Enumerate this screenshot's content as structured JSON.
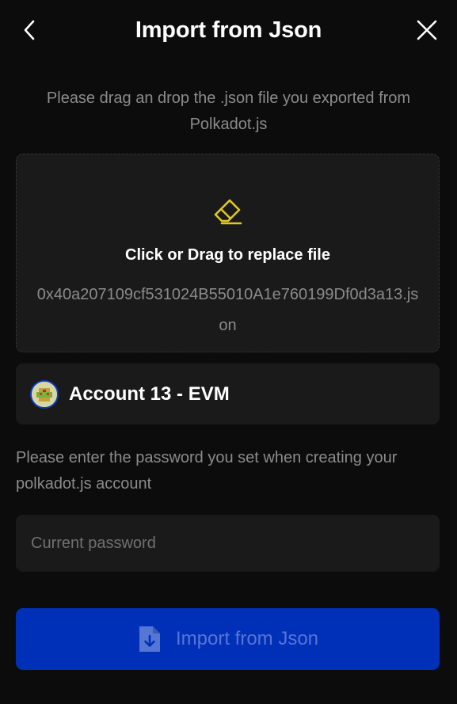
{
  "header": {
    "title": "Import from Json",
    "back_icon": "chevron-left-icon",
    "close_icon": "close-icon"
  },
  "instructions": "Please drag an drop the .json file you exported from Polkadot.js",
  "dropzone": {
    "icon": "eraser-icon",
    "label": "Click or Drag to replace file",
    "filename": "0x40a207109cf531024B55010A1e760199Df0d3a13.json"
  },
  "account": {
    "name": "Account 13 - EVM",
    "avatar_icon": "account-avatar"
  },
  "password": {
    "instructions": "Please enter the password you set when creating your polkadot.js account",
    "placeholder": "Current password",
    "value": ""
  },
  "import_button": {
    "label": "Import from Json",
    "icon": "file-download-icon"
  },
  "colors": {
    "background": "#0c0c0c",
    "card": "#1a1a1a",
    "accent_yellow": "#e0c820",
    "button_blue": "#0030b8",
    "muted_text": "#8b8b8b"
  }
}
